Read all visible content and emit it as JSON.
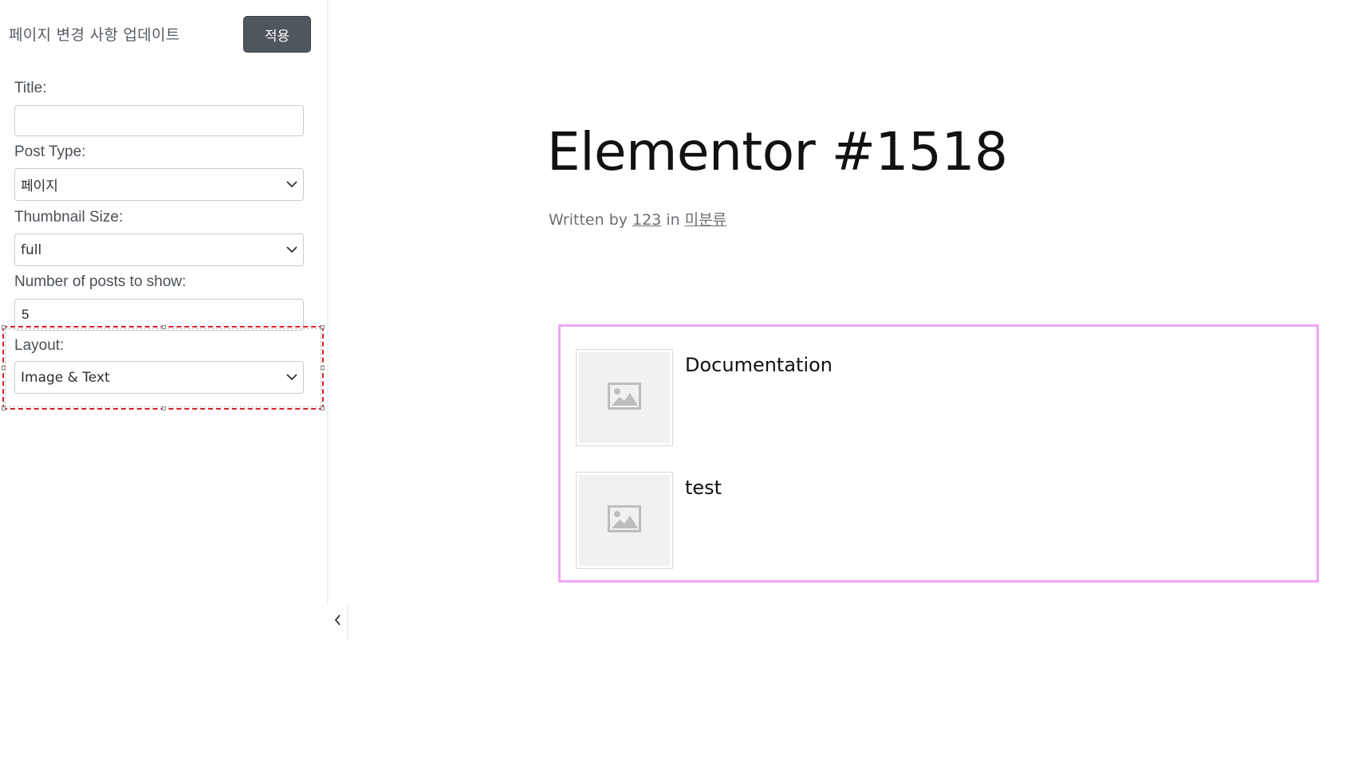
{
  "sidebar": {
    "header_title": "페이지 변경 사항 업데이트",
    "apply_label": "적용",
    "fields": {
      "title": {
        "label": "Title:",
        "value": "",
        "placeholder": ""
      },
      "post_type": {
        "label": "Post Type:",
        "value": "페이지"
      },
      "thumbnail_size": {
        "label": "Thumbnail Size:",
        "value": "full"
      },
      "num_posts": {
        "label": "Number of posts to show:",
        "value": "5"
      },
      "layout": {
        "label": "Layout:",
        "value": "Image & Text"
      }
    },
    "collapse_icon": "chevron-left-icon"
  },
  "page": {
    "title": "Elementor #1518",
    "meta_prefix": "Written by ",
    "author": "123",
    "meta_in": " in ",
    "category": "미분류"
  },
  "posts": [
    {
      "title": "Documentation",
      "thumbnail_icon": "image-placeholder-icon"
    },
    {
      "title": "test",
      "thumbnail_icon": "image-placeholder-icon"
    }
  ],
  "colors": {
    "apply_button_bg": "#4f565d",
    "selection_outline": "#d4202f",
    "posts_widget_border": "#f1a7f5"
  }
}
